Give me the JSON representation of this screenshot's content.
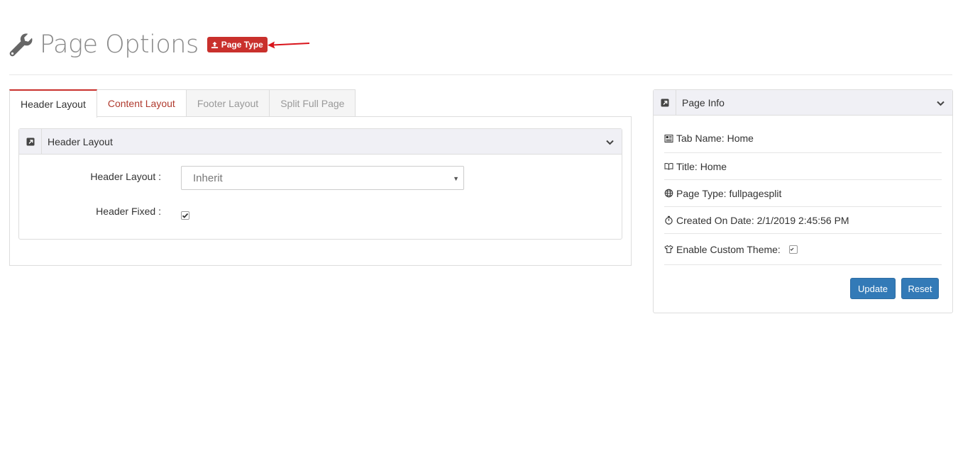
{
  "header": {
    "title": "Page Options",
    "badge_label": "Page Type"
  },
  "tabs": [
    {
      "label": "Header Layout",
      "state": "active"
    },
    {
      "label": "Content Layout",
      "state": "highlighted"
    },
    {
      "label": "Footer Layout",
      "state": "inactive"
    },
    {
      "label": "Split Full Page",
      "state": "inactive"
    }
  ],
  "header_panel": {
    "title": "Header Layout",
    "layout_label": "Header Layout :",
    "layout_value": "Inherit",
    "fixed_label": "Header Fixed :",
    "fixed_checked": true
  },
  "page_info": {
    "title": "Page Info",
    "tab_name": "Tab Name: Home",
    "title_line": "Title: Home",
    "page_type": "Page Type: fullpagesplit",
    "created": "Created On Date: 2/1/2019 2:45:56 PM",
    "custom_theme_label": "Enable Custom Theme:",
    "custom_theme_checked": true,
    "update_label": "Update",
    "reset_label": "Reset"
  },
  "colors": {
    "accent_red": "#c9302c",
    "primary_blue": "#337ab7",
    "panel_head": "#f0f0f5"
  }
}
